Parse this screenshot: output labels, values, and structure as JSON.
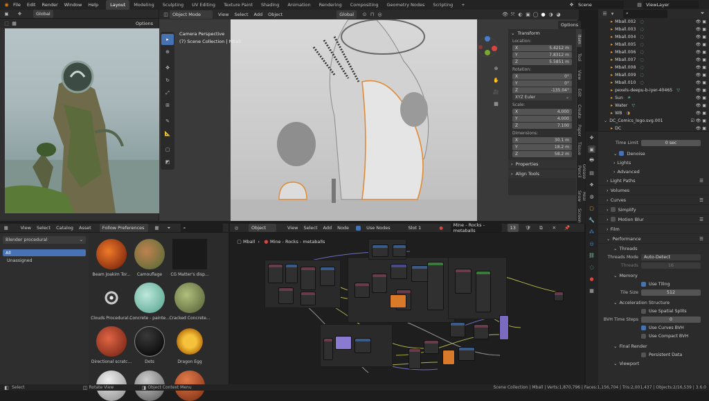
{
  "top_menu": {
    "items": [
      "File",
      "Edit",
      "Render",
      "Window",
      "Help"
    ],
    "workspaces": [
      "Layout",
      "Modeling",
      "Sculpting",
      "UV Editing",
      "Texture Paint",
      "Shading",
      "Animation",
      "Rendering",
      "Compositing",
      "Geometry Nodes",
      "Scripting"
    ],
    "active_workspace": "Layout",
    "add_tab": "+",
    "scene": "Scene",
    "view_layer": "ViewLayer"
  },
  "image_editor": {
    "transform": "Global",
    "options": "Options"
  },
  "viewport": {
    "mode": "Object Mode",
    "menu": [
      "View",
      "Select",
      "Add",
      "Object"
    ],
    "transform": "Global",
    "options": "Options",
    "overlay_line1": "Camera Perspective",
    "overlay_line2": "(7) Scene Collection | Mball",
    "tabs": [
      "Item",
      "Tool",
      "View",
      "Edit",
      "Create",
      "Paper",
      "Tissue",
      "Grease Pencil",
      "Real Snow",
      "Screen"
    ]
  },
  "npanel": {
    "transform_header": "Transform",
    "location_label": "Location:",
    "location": {
      "x": "5.4212 m",
      "y": "7.8312 m",
      "z": "5.5851 m"
    },
    "rotation_label": "Rotation:",
    "rotation": {
      "x": "0°",
      "y": "0°",
      "z": "-135.04°"
    },
    "rotation_mode": "XYZ Euler",
    "scale_label": "Scale:",
    "scale": {
      "x": "4.000",
      "y": "4.000",
      "z": "7.100"
    },
    "dimensions_label": "Dimensions:",
    "dimensions": {
      "x": "30.1 m",
      "y": "18.2 m",
      "z": "58.2 m"
    },
    "axes": [
      "X",
      "Y",
      "Z"
    ],
    "properties": "Properties",
    "align_tools": "Align Tools"
  },
  "outliner": {
    "rows": [
      {
        "name": "Mball.002"
      },
      {
        "name": "Mball.003"
      },
      {
        "name": "Mball.004"
      },
      {
        "name": "Mball.005"
      },
      {
        "name": "Mball.006"
      },
      {
        "name": "Mball.007"
      },
      {
        "name": "Mball.008"
      },
      {
        "name": "Mball.009"
      },
      {
        "name": "Mball.010"
      },
      {
        "name": "pexels-deepu-b-iyer-40465"
      },
      {
        "name": "Sun"
      },
      {
        "name": "Water"
      },
      {
        "name": "WB"
      },
      {
        "name": "DC_Comics_logo.svg.001"
      },
      {
        "name": "DC"
      }
    ]
  },
  "properties": {
    "time_limit_label": "Time Limit",
    "time_limit_value": "0 sec",
    "denoise": "Denoise",
    "lights": "Lights",
    "advanced": "Advanced",
    "light_paths": "Light Paths",
    "volumes": "Volumes",
    "curves": "Curves",
    "simplify": "Simplify",
    "motion_blur": "Motion Blur",
    "film": "Film",
    "performance": "Performance",
    "threads": "Threads",
    "threads_mode_label": "Threads Mode",
    "threads_mode_value": "Auto-Detect",
    "threads_label": "Threads",
    "threads_value": "16",
    "memory": "Memory",
    "use_tiling": "Use Tiling",
    "tile_size_label": "Tile Size",
    "tile_size_value": "512",
    "accel_structure": "Acceleration Structure",
    "use_spatial_splits": "Use Spatial Splits",
    "bvh_steps_label": "BVH Time Steps",
    "bvh_steps_value": "0",
    "use_curves_bvh": "Use Curves BVH",
    "use_compact_bvh": "Use Compact BVH",
    "final_render": "Final Render",
    "persistent_data": "Persistent Data",
    "viewport": "Viewport"
  },
  "asset_browser": {
    "menu": [
      "View",
      "Select",
      "Catalog",
      "Asset"
    ],
    "follow_prefs": "Follow Preferences",
    "library": "Blender procedural",
    "catalogs": [
      "All",
      "Unassigned"
    ],
    "assets": [
      {
        "name": "Beam Joakim Tor...",
        "color": "#c23a12"
      },
      {
        "name": "Camouflage",
        "color": "#7a8a3a"
      },
      {
        "name": "CG Matter's disp...",
        "color": "#262626"
      },
      {
        "name": "Clouds Procedural...",
        "color": "#d8d8d8"
      },
      {
        "name": "Concrete - painte...",
        "color": "#7fc9b3"
      },
      {
        "name": "Cracked Concrete...",
        "color": "#7f8f5f"
      },
      {
        "name": "Directional scratc...",
        "color": "#b0301c"
      },
      {
        "name": "Dots",
        "color": "#050505"
      },
      {
        "name": "Dragon Egg",
        "color": "#d9a21a"
      }
    ]
  },
  "node_editor": {
    "type": "Object",
    "menu": [
      "View",
      "Select",
      "Add",
      "Node"
    ],
    "use_nodes": "Use Nodes",
    "slot": "Slot 1",
    "material": "Mine - Rocks - metaballs",
    "users": "13",
    "breadcrumb_object": "Mball",
    "breadcrumb_material": "Mine - Rocks - metaballs"
  },
  "status_bar": {
    "left": [
      "Select",
      "Rotate View",
      "Object Context Menu"
    ],
    "right": "Scene Collection | Mball | Verts:1,870,796 | Faces:1,156,704 | Tris:2,001,437 | Objects:2/16,539 | 3.6.0"
  }
}
